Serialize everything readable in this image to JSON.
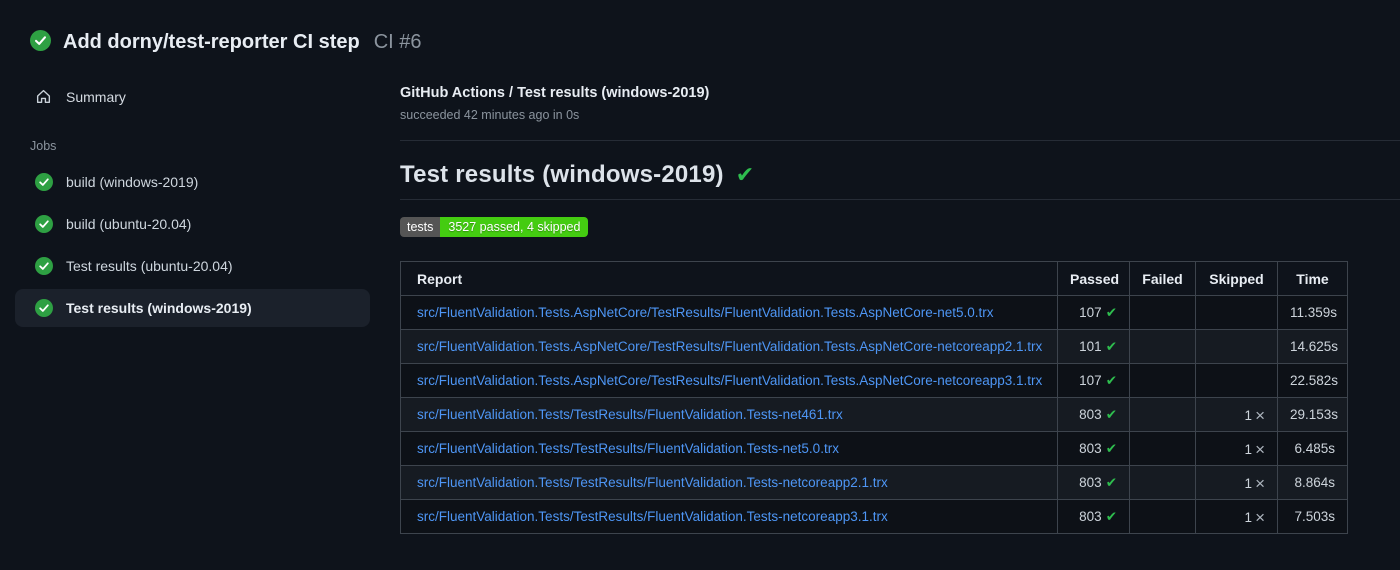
{
  "colors": {
    "accent_green": "#2ea043",
    "badge_green": "#44cc11",
    "badge_gray": "#555555",
    "link_blue": "#4e96f5",
    "background": "#0e131b"
  },
  "icons": {
    "check_glyph": "✔",
    "x_glyph": "×"
  },
  "header": {
    "title": "Add dorny/test-reporter CI step",
    "run_number": "CI #6"
  },
  "sidebar": {
    "summary_label": "Summary",
    "jobs_label": "Jobs",
    "items": [
      {
        "label": "build (windows-2019)",
        "selected": false
      },
      {
        "label": "build (ubuntu-20.04)",
        "selected": false
      },
      {
        "label": "Test results (ubuntu-20.04)",
        "selected": false
      },
      {
        "label": "Test results (windows-2019)",
        "selected": true
      }
    ]
  },
  "job": {
    "title": "GitHub Actions / Test results (windows-2019)",
    "status_line": "succeeded 42 minutes ago in 0s"
  },
  "report": {
    "heading": "Test results (windows-2019)",
    "badge_label": "tests",
    "badge_value": "3527 passed, 4 skipped"
  },
  "table": {
    "headers": {
      "report": "Report",
      "passed": "Passed",
      "failed": "Failed",
      "skipped": "Skipped",
      "time": "Time"
    },
    "rows": [
      {
        "report": "src/FluentValidation.Tests.AspNetCore/TestResults/FluentValidation.Tests.AspNetCore-net5.0.trx",
        "passed": "107",
        "failed": "",
        "skipped": "",
        "time": "11.359s"
      },
      {
        "report": "src/FluentValidation.Tests.AspNetCore/TestResults/FluentValidation.Tests.AspNetCore-netcoreapp2.1.trx",
        "passed": "101",
        "failed": "",
        "skipped": "",
        "time": "14.625s"
      },
      {
        "report": "src/FluentValidation.Tests.AspNetCore/TestResults/FluentValidation.Tests.AspNetCore-netcoreapp3.1.trx",
        "passed": "107",
        "failed": "",
        "skipped": "",
        "time": "22.582s"
      },
      {
        "report": "src/FluentValidation.Tests/TestResults/FluentValidation.Tests-net461.trx",
        "passed": "803",
        "failed": "",
        "skipped": "1",
        "time": "29.153s"
      },
      {
        "report": "src/FluentValidation.Tests/TestResults/FluentValidation.Tests-net5.0.trx",
        "passed": "803",
        "failed": "",
        "skipped": "1",
        "time": "6.485s"
      },
      {
        "report": "src/FluentValidation.Tests/TestResults/FluentValidation.Tests-netcoreapp2.1.trx",
        "passed": "803",
        "failed": "",
        "skipped": "1",
        "time": "8.864s"
      },
      {
        "report": "src/FluentValidation.Tests/TestResults/FluentValidation.Tests-netcoreapp3.1.trx",
        "passed": "803",
        "failed": "",
        "skipped": "1",
        "time": "7.503s"
      }
    ]
  }
}
